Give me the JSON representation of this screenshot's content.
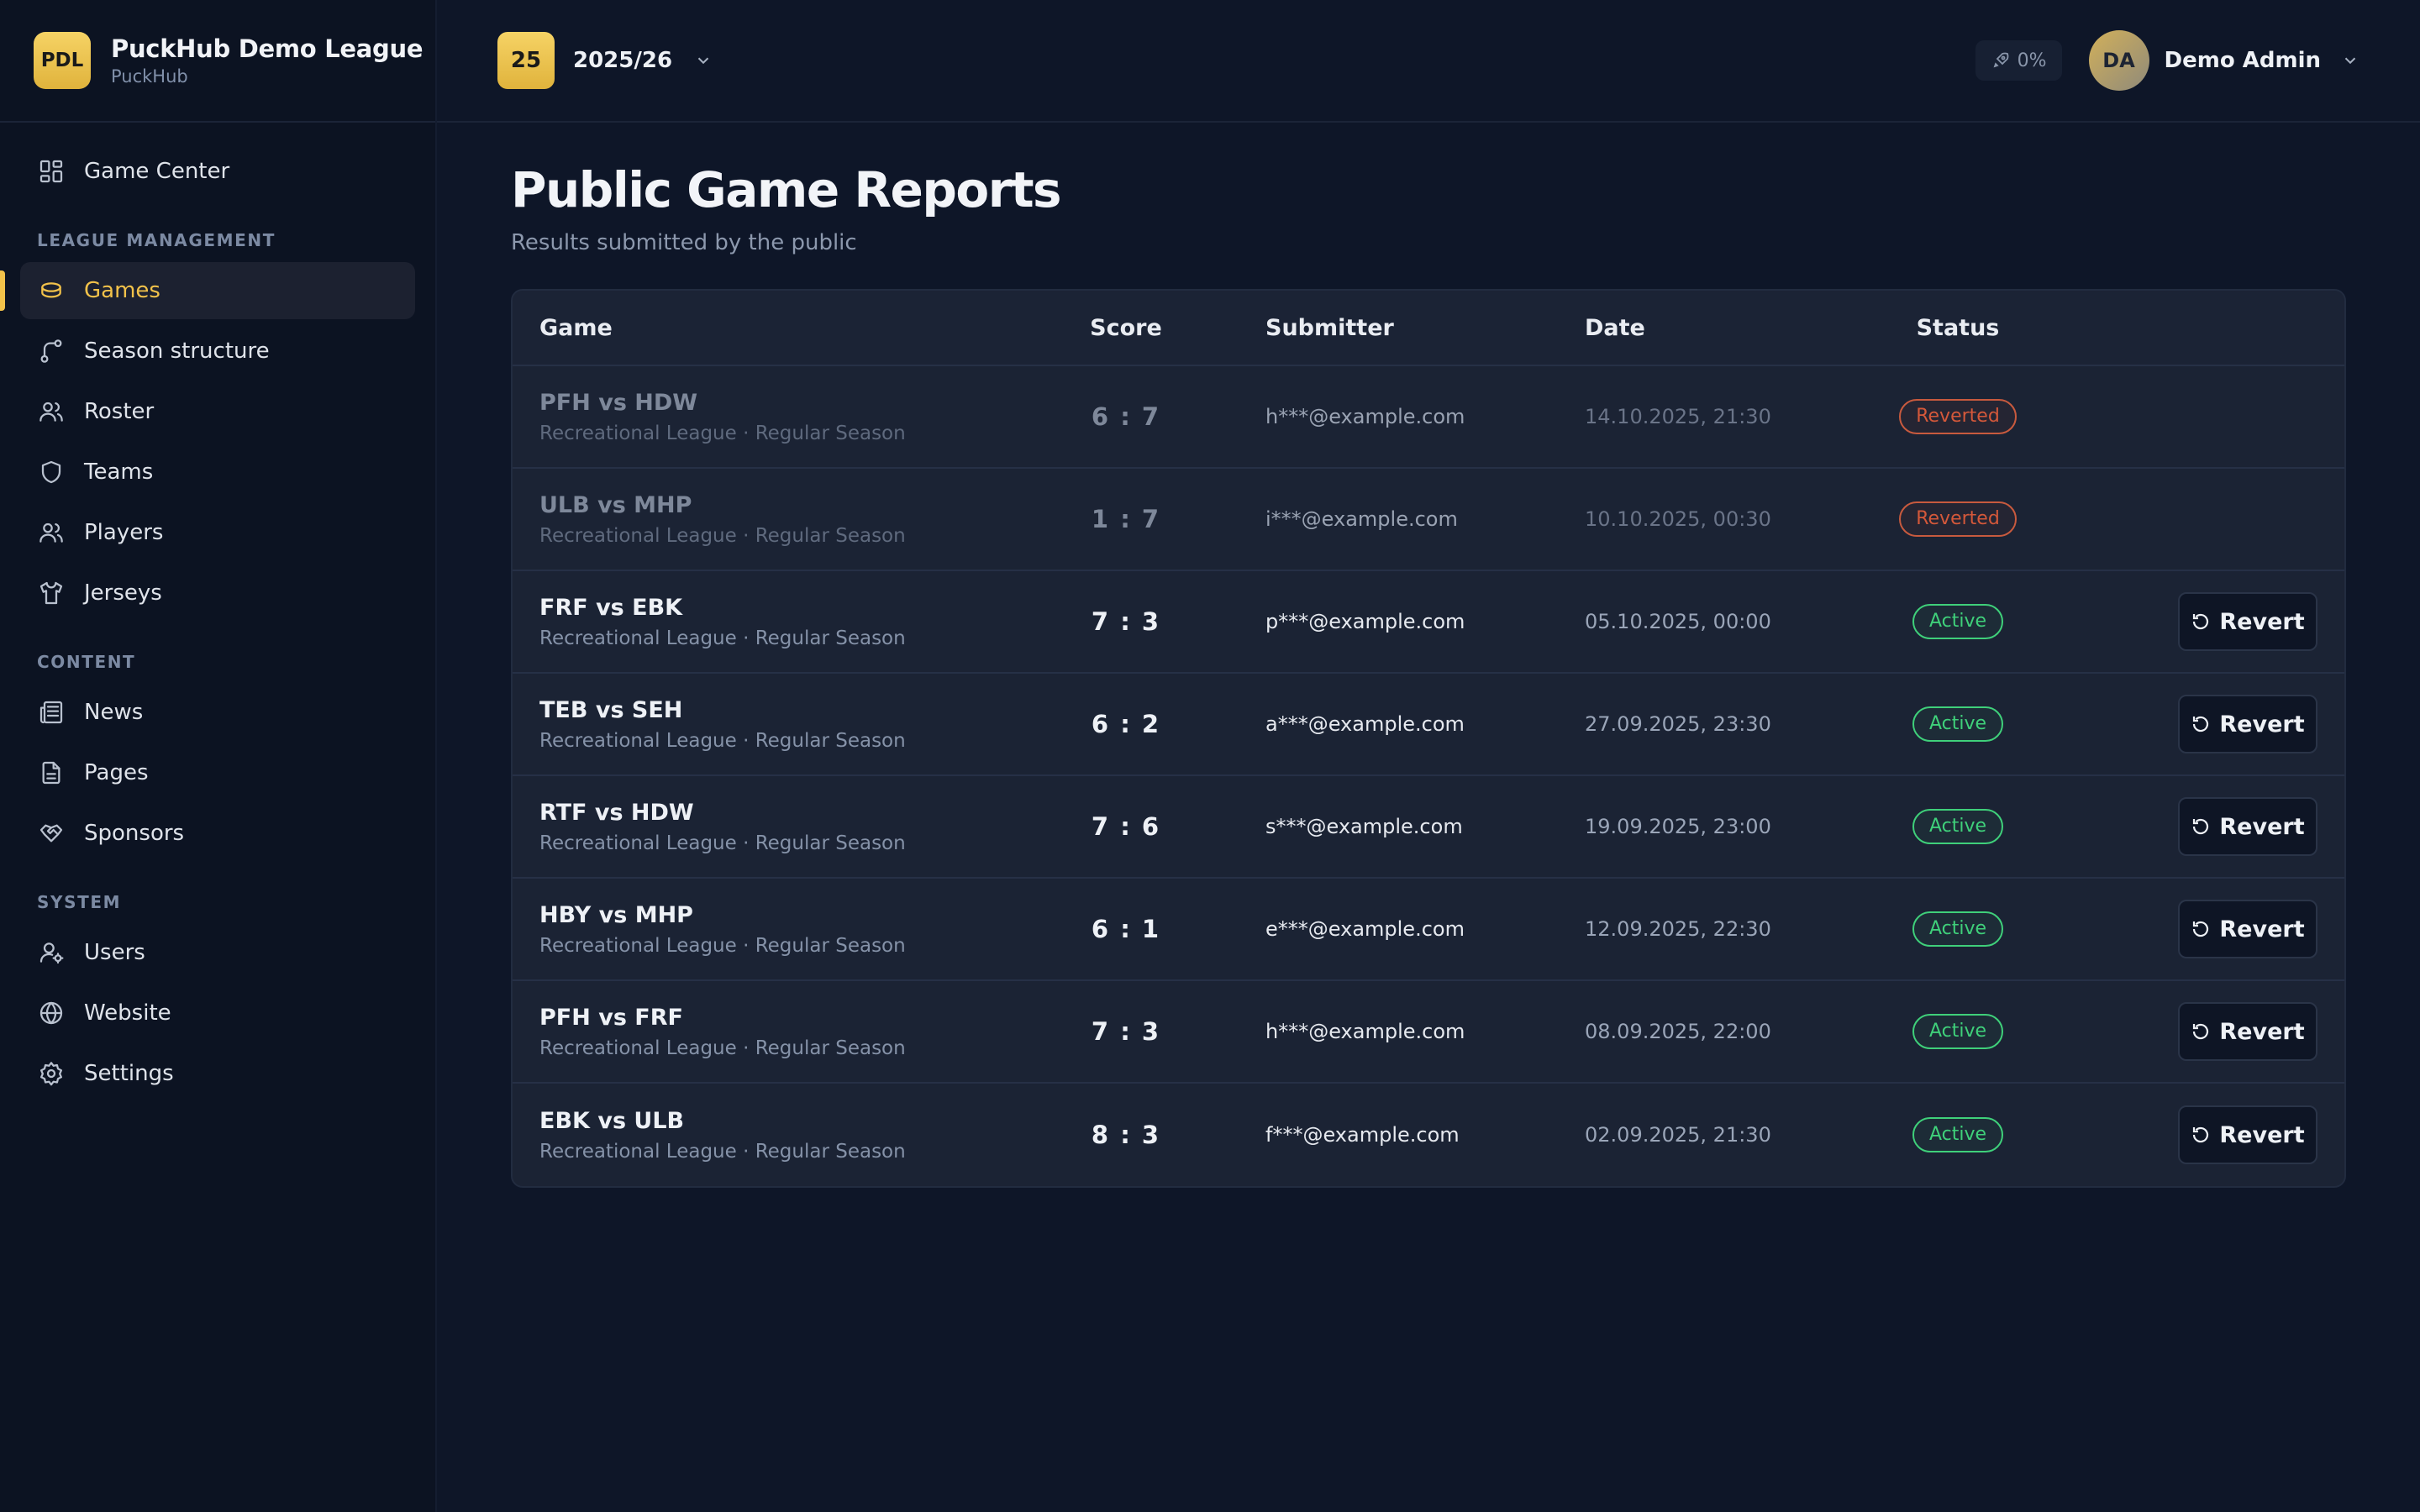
{
  "brand": {
    "logo": "PDL",
    "title": "PuckHub Demo League",
    "subtitle": "PuckHub"
  },
  "nav": {
    "game_center": "Game Center",
    "section_league": "League Management",
    "games": "Games",
    "season_structure": "Season structure",
    "roster": "Roster",
    "teams": "Teams",
    "players": "Players",
    "jerseys": "Jerseys",
    "section_content": "Content",
    "news": "News",
    "pages": "Pages",
    "sponsors": "Sponsors",
    "section_system": "System",
    "users": "Users",
    "website": "Website",
    "settings": "Settings"
  },
  "topbar": {
    "season_badge": "25",
    "season_label": "2025/26",
    "progress": "0%",
    "avatar": "DA",
    "user_name": "Demo Admin"
  },
  "page": {
    "title": "Public Game Reports",
    "subtitle": "Results submitted by the public"
  },
  "table": {
    "headers": {
      "game": "Game",
      "score": "Score",
      "submitter": "Submitter",
      "date": "Date",
      "status": "Status"
    },
    "revert_label": "Revert",
    "rows": [
      {
        "game": "PFH vs HDW",
        "meta": "Recreational League · Regular Season",
        "score": "6 : 7",
        "submitter": "h***@example.com",
        "date": "14.10.2025, 21:30",
        "status": "Reverted"
      },
      {
        "game": "ULB vs MHP",
        "meta": "Recreational League · Regular Season",
        "score": "1 : 7",
        "submitter": "i***@example.com",
        "date": "10.10.2025, 00:30",
        "status": "Reverted"
      },
      {
        "game": "FRF vs EBK",
        "meta": "Recreational League · Regular Season",
        "score": "7 : 3",
        "submitter": "p***@example.com",
        "date": "05.10.2025, 00:00",
        "status": "Active"
      },
      {
        "game": "TEB vs SEH",
        "meta": "Recreational League · Regular Season",
        "score": "6 : 2",
        "submitter": "a***@example.com",
        "date": "27.09.2025, 23:30",
        "status": "Active"
      },
      {
        "game": "RTF vs HDW",
        "meta": "Recreational League · Regular Season",
        "score": "7 : 6",
        "submitter": "s***@example.com",
        "date": "19.09.2025, 23:00",
        "status": "Active"
      },
      {
        "game": "HBY vs MHP",
        "meta": "Recreational League · Regular Season",
        "score": "6 : 1",
        "submitter": "e***@example.com",
        "date": "12.09.2025, 22:30",
        "status": "Active"
      },
      {
        "game": "PFH vs FRF",
        "meta": "Recreational League · Regular Season",
        "score": "7 : 3",
        "submitter": "h***@example.com",
        "date": "08.09.2025, 22:00",
        "status": "Active"
      },
      {
        "game": "EBK vs ULB",
        "meta": "Recreational League · Regular Season",
        "score": "8 : 3",
        "submitter": "f***@example.com",
        "date": "02.09.2025, 21:30",
        "status": "Active"
      }
    ]
  },
  "colors": {
    "accent": "#f2c24a",
    "active": "#3fd07a",
    "reverted": "#d4583a",
    "background": "#0e1628"
  }
}
